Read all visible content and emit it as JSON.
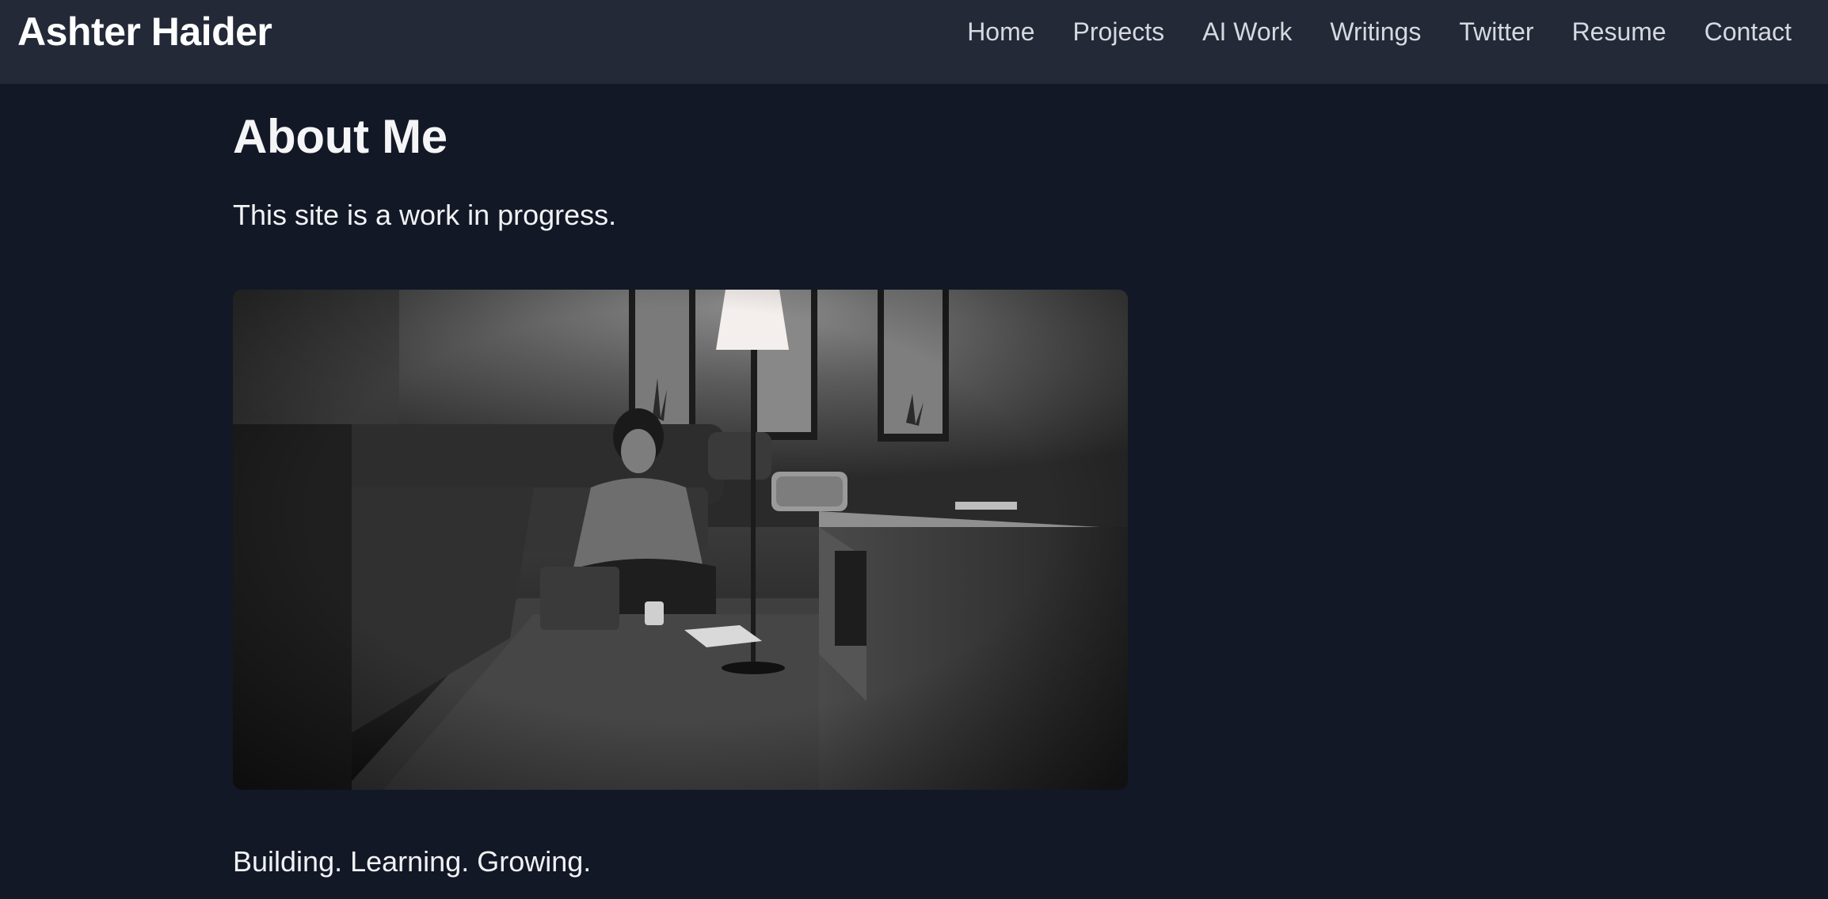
{
  "header": {
    "brand": "Ashter Haider",
    "nav": [
      "Home",
      "Projects",
      "AI Work",
      "Writings",
      "Twitter",
      "Resume",
      "Contact"
    ]
  },
  "main": {
    "title": "About Me",
    "intro": "This site is a work in progress.",
    "photo_subject": "person sitting on floor in dim living room with floor lamp, black and white",
    "tagline": "Building. Learning. Growing."
  },
  "colors": {
    "background": "#121826",
    "navbar": "#232937",
    "text": "#f3f4f6",
    "nav_text": "#d6d9e0"
  }
}
